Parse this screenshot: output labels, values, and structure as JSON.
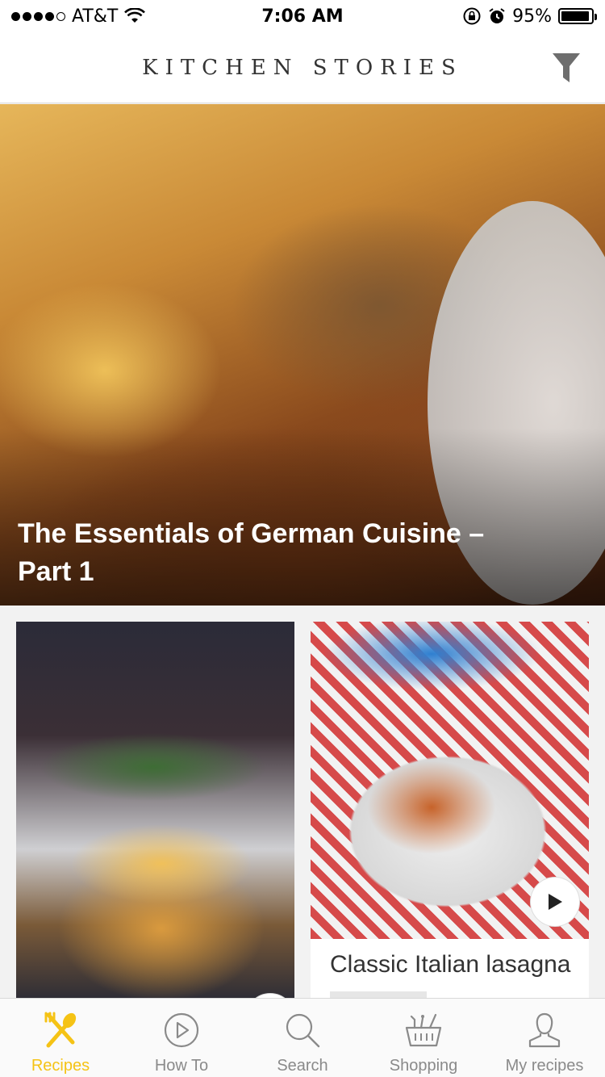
{
  "status_bar": {
    "carrier": "AT&T",
    "time": "7:06 AM",
    "battery": "95%",
    "battery_level": 0.95
  },
  "header": {
    "title": "KITCHEN STORIES"
  },
  "hero": {
    "title": "The Essentials of German Cuisine – Part 1"
  },
  "cards": [
    {
      "title": ""
    },
    {
      "title": "Classic Italian lasagna"
    }
  ],
  "tab_bar": {
    "items": [
      {
        "label": "Recipes",
        "icon": "recipes-icon",
        "active": true
      },
      {
        "label": "How To",
        "icon": "play-circle-icon",
        "active": false
      },
      {
        "label": "Search",
        "icon": "search-icon",
        "active": false
      },
      {
        "label": "Shopping",
        "icon": "basket-icon",
        "active": false
      },
      {
        "label": "My recipes",
        "icon": "person-icon",
        "active": false
      }
    ],
    "active_color": "#f5c315",
    "inactive_color": "#8a8a8a"
  }
}
